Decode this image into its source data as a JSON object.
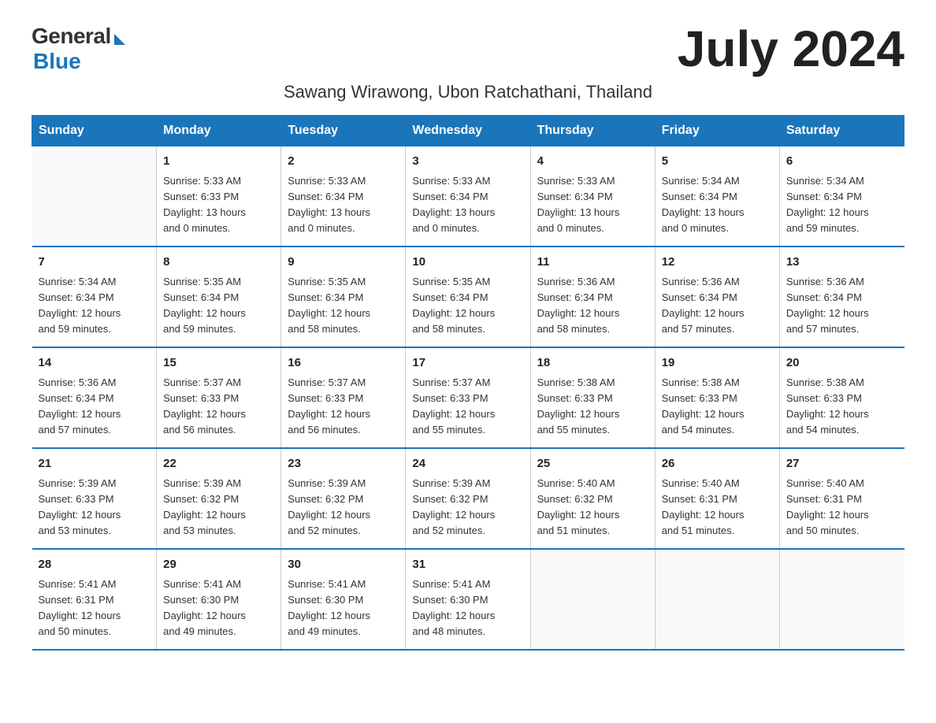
{
  "logo": {
    "general": "General",
    "blue": "Blue"
  },
  "title": "July 2024",
  "location": "Sawang Wirawong, Ubon Ratchathani, Thailand",
  "days_header": [
    "Sunday",
    "Monday",
    "Tuesday",
    "Wednesday",
    "Thursday",
    "Friday",
    "Saturday"
  ],
  "weeks": [
    [
      {
        "num": "",
        "info": ""
      },
      {
        "num": "1",
        "info": "Sunrise: 5:33 AM\nSunset: 6:33 PM\nDaylight: 13 hours\nand 0 minutes."
      },
      {
        "num": "2",
        "info": "Sunrise: 5:33 AM\nSunset: 6:34 PM\nDaylight: 13 hours\nand 0 minutes."
      },
      {
        "num": "3",
        "info": "Sunrise: 5:33 AM\nSunset: 6:34 PM\nDaylight: 13 hours\nand 0 minutes."
      },
      {
        "num": "4",
        "info": "Sunrise: 5:33 AM\nSunset: 6:34 PM\nDaylight: 13 hours\nand 0 minutes."
      },
      {
        "num": "5",
        "info": "Sunrise: 5:34 AM\nSunset: 6:34 PM\nDaylight: 13 hours\nand 0 minutes."
      },
      {
        "num": "6",
        "info": "Sunrise: 5:34 AM\nSunset: 6:34 PM\nDaylight: 12 hours\nand 59 minutes."
      }
    ],
    [
      {
        "num": "7",
        "info": "Sunrise: 5:34 AM\nSunset: 6:34 PM\nDaylight: 12 hours\nand 59 minutes."
      },
      {
        "num": "8",
        "info": "Sunrise: 5:35 AM\nSunset: 6:34 PM\nDaylight: 12 hours\nand 59 minutes."
      },
      {
        "num": "9",
        "info": "Sunrise: 5:35 AM\nSunset: 6:34 PM\nDaylight: 12 hours\nand 58 minutes."
      },
      {
        "num": "10",
        "info": "Sunrise: 5:35 AM\nSunset: 6:34 PM\nDaylight: 12 hours\nand 58 minutes."
      },
      {
        "num": "11",
        "info": "Sunrise: 5:36 AM\nSunset: 6:34 PM\nDaylight: 12 hours\nand 58 minutes."
      },
      {
        "num": "12",
        "info": "Sunrise: 5:36 AM\nSunset: 6:34 PM\nDaylight: 12 hours\nand 57 minutes."
      },
      {
        "num": "13",
        "info": "Sunrise: 5:36 AM\nSunset: 6:34 PM\nDaylight: 12 hours\nand 57 minutes."
      }
    ],
    [
      {
        "num": "14",
        "info": "Sunrise: 5:36 AM\nSunset: 6:34 PM\nDaylight: 12 hours\nand 57 minutes."
      },
      {
        "num": "15",
        "info": "Sunrise: 5:37 AM\nSunset: 6:33 PM\nDaylight: 12 hours\nand 56 minutes."
      },
      {
        "num": "16",
        "info": "Sunrise: 5:37 AM\nSunset: 6:33 PM\nDaylight: 12 hours\nand 56 minutes."
      },
      {
        "num": "17",
        "info": "Sunrise: 5:37 AM\nSunset: 6:33 PM\nDaylight: 12 hours\nand 55 minutes."
      },
      {
        "num": "18",
        "info": "Sunrise: 5:38 AM\nSunset: 6:33 PM\nDaylight: 12 hours\nand 55 minutes."
      },
      {
        "num": "19",
        "info": "Sunrise: 5:38 AM\nSunset: 6:33 PM\nDaylight: 12 hours\nand 54 minutes."
      },
      {
        "num": "20",
        "info": "Sunrise: 5:38 AM\nSunset: 6:33 PM\nDaylight: 12 hours\nand 54 minutes."
      }
    ],
    [
      {
        "num": "21",
        "info": "Sunrise: 5:39 AM\nSunset: 6:33 PM\nDaylight: 12 hours\nand 53 minutes."
      },
      {
        "num": "22",
        "info": "Sunrise: 5:39 AM\nSunset: 6:32 PM\nDaylight: 12 hours\nand 53 minutes."
      },
      {
        "num": "23",
        "info": "Sunrise: 5:39 AM\nSunset: 6:32 PM\nDaylight: 12 hours\nand 52 minutes."
      },
      {
        "num": "24",
        "info": "Sunrise: 5:39 AM\nSunset: 6:32 PM\nDaylight: 12 hours\nand 52 minutes."
      },
      {
        "num": "25",
        "info": "Sunrise: 5:40 AM\nSunset: 6:32 PM\nDaylight: 12 hours\nand 51 minutes."
      },
      {
        "num": "26",
        "info": "Sunrise: 5:40 AM\nSunset: 6:31 PM\nDaylight: 12 hours\nand 51 minutes."
      },
      {
        "num": "27",
        "info": "Sunrise: 5:40 AM\nSunset: 6:31 PM\nDaylight: 12 hours\nand 50 minutes."
      }
    ],
    [
      {
        "num": "28",
        "info": "Sunrise: 5:41 AM\nSunset: 6:31 PM\nDaylight: 12 hours\nand 50 minutes."
      },
      {
        "num": "29",
        "info": "Sunrise: 5:41 AM\nSunset: 6:30 PM\nDaylight: 12 hours\nand 49 minutes."
      },
      {
        "num": "30",
        "info": "Sunrise: 5:41 AM\nSunset: 6:30 PM\nDaylight: 12 hours\nand 49 minutes."
      },
      {
        "num": "31",
        "info": "Sunrise: 5:41 AM\nSunset: 6:30 PM\nDaylight: 12 hours\nand 48 minutes."
      },
      {
        "num": "",
        "info": ""
      },
      {
        "num": "",
        "info": ""
      },
      {
        "num": "",
        "info": ""
      }
    ]
  ]
}
